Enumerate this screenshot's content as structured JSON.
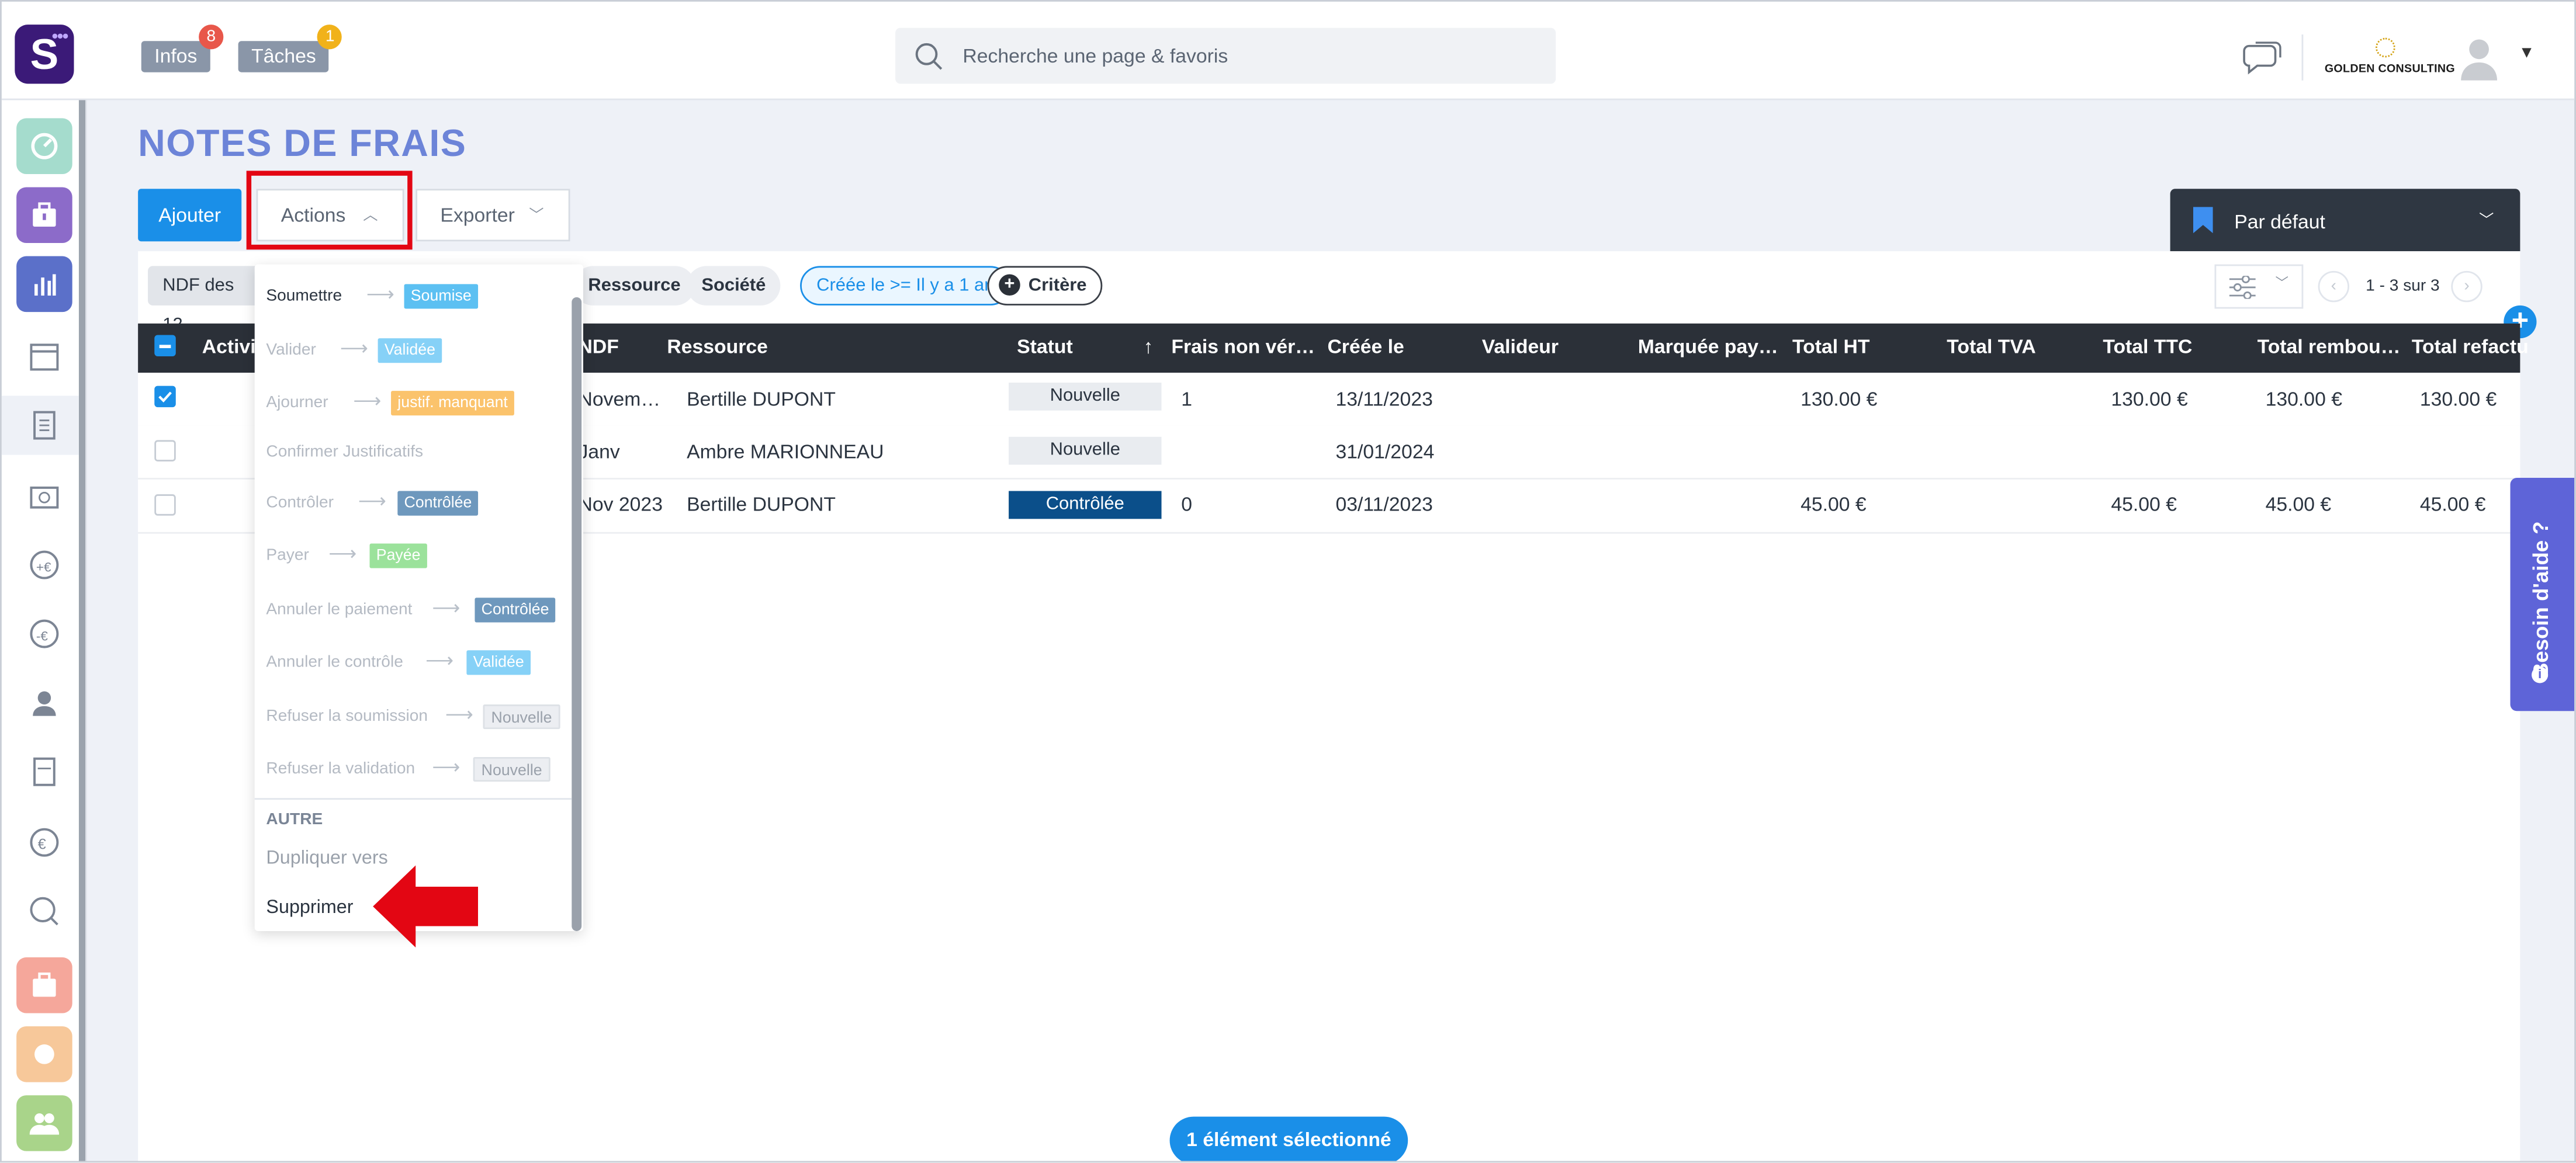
{
  "header": {
    "logo_letter": "S",
    "infos_label": "Infos",
    "infos_count": "8",
    "tasks_label": "Tâches",
    "tasks_count": "1",
    "search_placeholder": "Recherche une page & favoris",
    "company_name": "GOLDEN CONSULTING"
  },
  "page": {
    "title": "NOTES DE FRAIS",
    "add_label": "Ajouter",
    "actions_label": "Actions",
    "export_label": "Exporter",
    "view_label": "Par défaut",
    "pagination": "1 - 3 sur 3",
    "help_label": "Besoin d'aide ?",
    "selection_label": "1 élément sélectionné"
  },
  "filters": {
    "chip1": "NDF des 12",
    "chip2": "Ressource",
    "chip3": "Société",
    "chip4": "Créée le >= Il y a 1 an",
    "criteria": "Critère"
  },
  "table": {
    "headers": [
      "Activité",
      "NDF",
      "Ressource",
      "Statut",
      "Frais non vér…",
      "Créée le",
      "Valideur",
      "Marquée pay…",
      "Total HT",
      "Total TVA",
      "Total TTC",
      "Total rembou…",
      "Total refactu"
    ],
    "rows": [
      {
        "ndf": "Novem…",
        "resource": "Bertille DUPONT",
        "status": "Nouvelle",
        "frais": "1",
        "created": "13/11/2023",
        "ht": "130.00 €",
        "ttc": "130.00 €",
        "remb": "130.00 €",
        "refac": "130.00 €"
      },
      {
        "ndf": "Janv",
        "resource": "Ambre MARIONNEAU",
        "status": "Nouvelle",
        "frais": "",
        "created": "31/01/2024",
        "ht": "",
        "ttc": "",
        "remb": "",
        "refac": ""
      },
      {
        "ndf": "Nov 2023",
        "resource": "Bertille DUPONT",
        "status": "Contrôlée",
        "frais": "0",
        "created": "03/11/2023",
        "ht": "45.00 €",
        "ttc": "45.00 €",
        "remb": "45.00 €",
        "refac": "45.00 €"
      }
    ]
  },
  "menu": {
    "items": [
      {
        "label": "Soumettre",
        "target": "Soumise"
      },
      {
        "label": "Valider",
        "target": "Validée"
      },
      {
        "label": "Ajourner",
        "target": "justif. manquant"
      },
      {
        "label": "Confirmer Justificatifs",
        "target": ""
      },
      {
        "label": "Contrôler",
        "target": "Contrôlée"
      },
      {
        "label": "Payer",
        "target": "Payée"
      },
      {
        "label": "Annuler le paiement",
        "target": "Contrôlée"
      },
      {
        "label": "Annuler le contrôle",
        "target": "Validée"
      },
      {
        "label": "Refuser la soumission",
        "target": "Nouvelle"
      },
      {
        "label": "Refuser la validation",
        "target": "Nouvelle"
      }
    ],
    "section_other": "AUTRE",
    "duplicate": "Dupliquer vers",
    "delete": "Supprimer"
  },
  "colors": {
    "primary": "#1a8fe8",
    "title": "#6c84d8",
    "annotation": "#e30613",
    "brand": "#3b1a78"
  }
}
